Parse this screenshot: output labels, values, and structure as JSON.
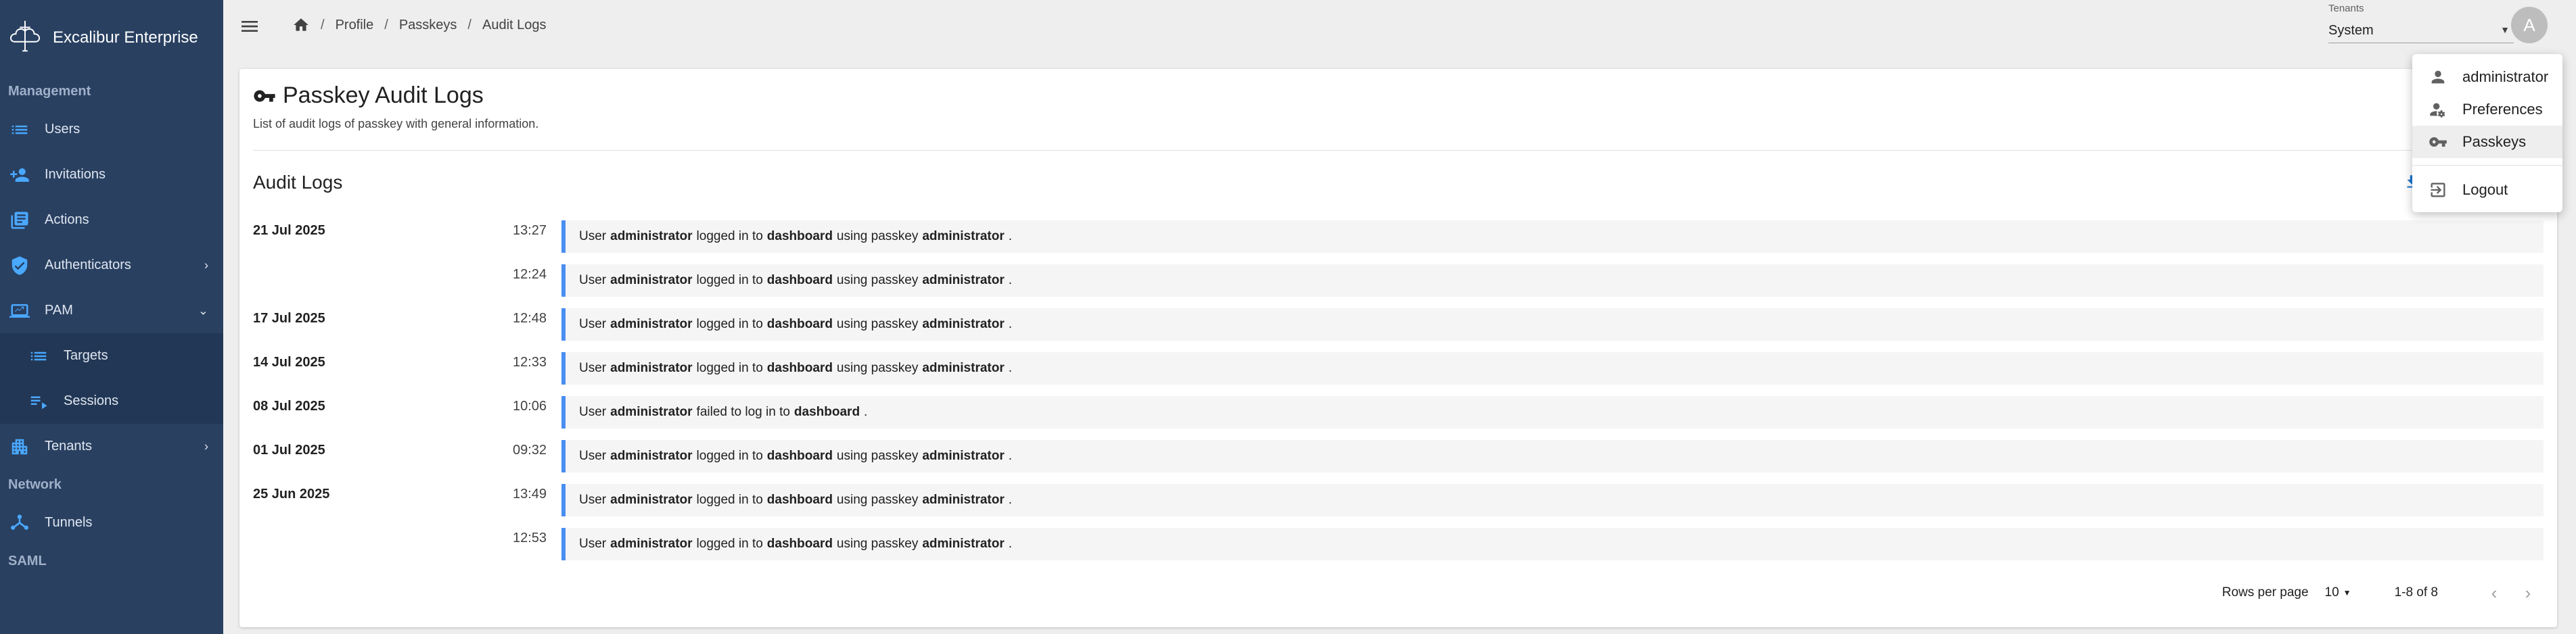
{
  "app": {
    "name": "Excalibur Enterprise"
  },
  "sidebar": {
    "sections": {
      "management": "Management",
      "network": "Network",
      "saml": "SAML"
    },
    "items": {
      "users": "Users",
      "invitations": "Invitations",
      "actions": "Actions",
      "authenticators": "Authenticators",
      "pam": "PAM",
      "targets": "Targets",
      "sessions": "Sessions",
      "tenants": "Tenants",
      "tunnels": "Tunnels"
    }
  },
  "breadcrumb": [
    "Profile",
    "Passkeys",
    "Audit Logs"
  ],
  "tenants": {
    "label": "Tenants",
    "value": "System"
  },
  "avatar": {
    "initial": "A"
  },
  "page": {
    "title": "Passkey Audit Logs",
    "description": "List of audit logs of passkey with general information.",
    "section_title": "Audit Logs",
    "export_label": "E"
  },
  "logs": [
    {
      "date": "21 Jul 2025",
      "time": "13:27",
      "parts": [
        "User",
        "administrator",
        "logged in to",
        "dashboard",
        "using passkey",
        "administrator",
        "."
      ]
    },
    {
      "date": "",
      "time": "12:24",
      "parts": [
        "User",
        "administrator",
        "logged in to",
        "dashboard",
        "using passkey",
        "administrator",
        "."
      ]
    },
    {
      "date": "17 Jul 2025",
      "time": "12:48",
      "parts": [
        "User",
        "administrator",
        "logged in to",
        "dashboard",
        "using passkey",
        "administrator",
        "."
      ]
    },
    {
      "date": "14 Jul 2025",
      "time": "12:33",
      "parts": [
        "User",
        "administrator",
        "logged in to",
        "dashboard",
        "using passkey",
        "administrator",
        "."
      ]
    },
    {
      "date": "08 Jul 2025",
      "time": "10:06",
      "parts": [
        "User",
        "administrator",
        "failed to log in to",
        "dashboard",
        ".",
        "",
        ""
      ]
    },
    {
      "date": "01 Jul 2025",
      "time": "09:32",
      "parts": [
        "User",
        "administrator",
        "logged in to",
        "dashboard",
        "using passkey",
        "administrator",
        "."
      ]
    },
    {
      "date": "25 Jun 2025",
      "time": "13:49",
      "parts": [
        "User",
        "administrator",
        "logged in to",
        "dashboard",
        "using passkey",
        "administrator",
        "."
      ]
    },
    {
      "date": "",
      "time": "12:53",
      "parts": [
        "User",
        "administrator",
        "logged in to",
        "dashboard",
        "using passkey",
        "administrator",
        "."
      ]
    }
  ],
  "pagination": {
    "rows_per_page_label": "Rows per page",
    "rows_per_page": "10",
    "range": "1-8 of 8"
  },
  "user_menu": {
    "username": "administrator",
    "preferences": "Preferences",
    "passkeys": "Passkeys",
    "logout": "Logout"
  },
  "colors": {
    "sidebar": "#294061",
    "accent": "#4a8ef2",
    "link": "#1976d2"
  }
}
